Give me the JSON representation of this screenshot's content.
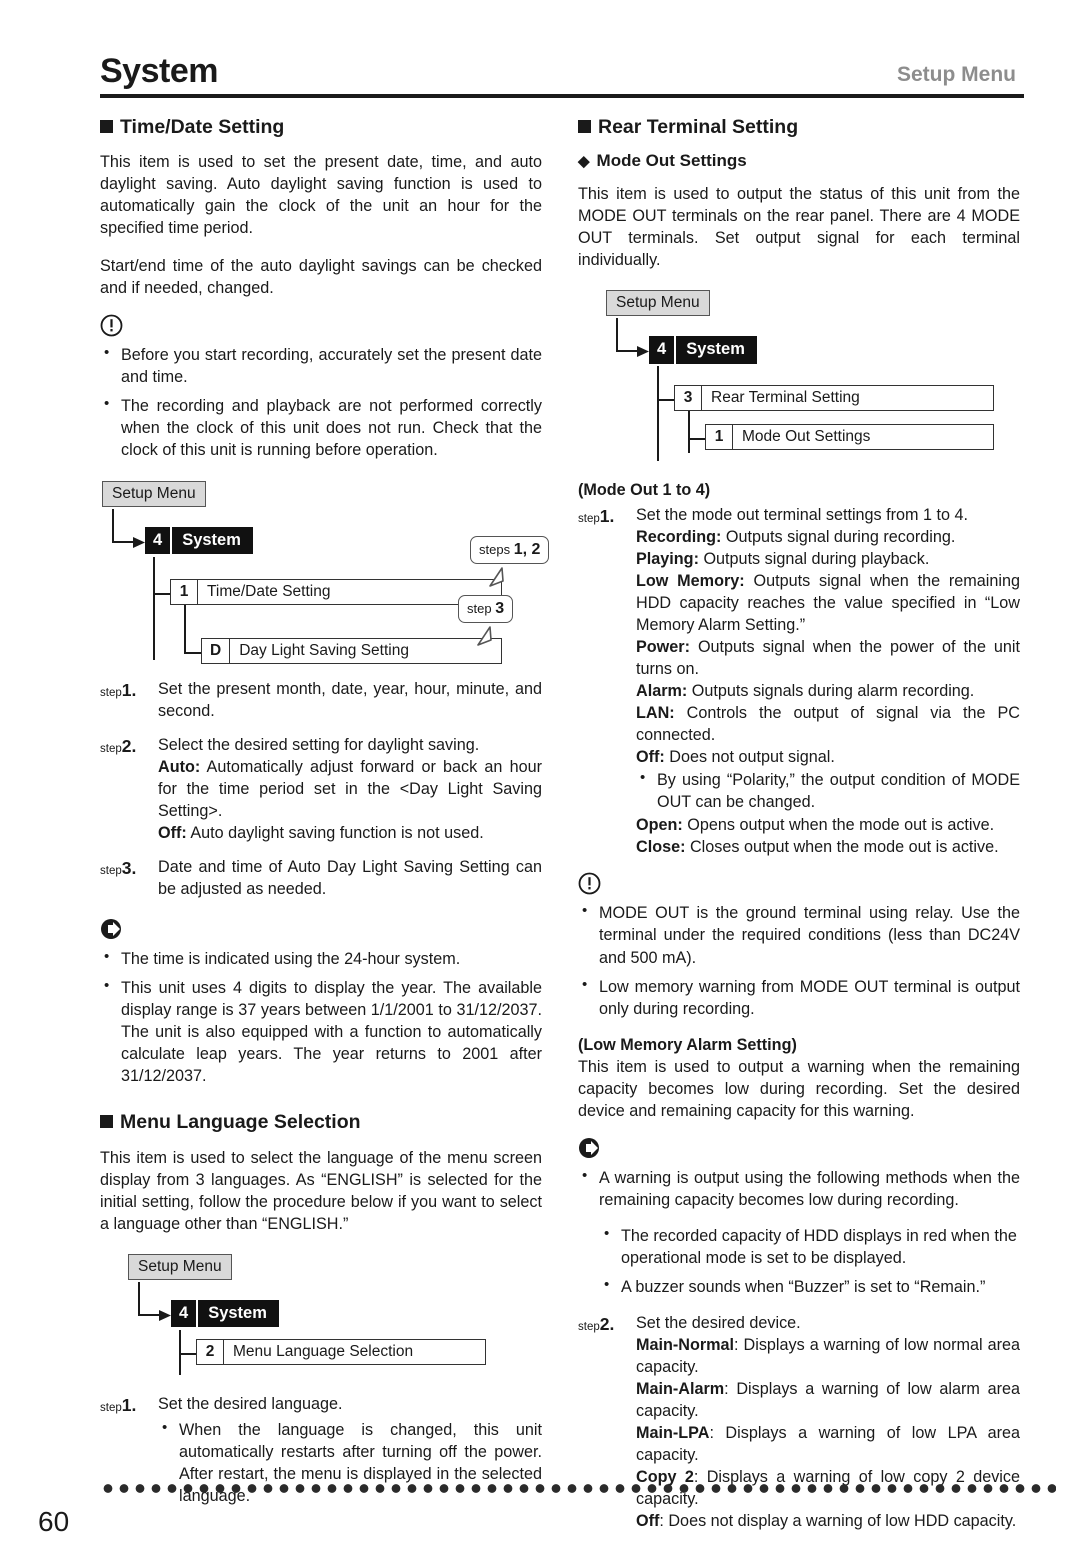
{
  "header": {
    "title": "System",
    "subtitle": "Setup Menu"
  },
  "footer": {
    "page_number": "60"
  },
  "left_column": {
    "section1": {
      "heading": "Time/Date Setting",
      "intro1": "This item is used to set the present date, time, and auto daylight saving. Auto daylight saving function is used to automatically gain the clock of the unit an hour for the specified time period.",
      "intro2": "Start/end time of the auto daylight savings can be checked and if needed, changed.",
      "caution_icon": "warning-exclamation-icon",
      "caution_bullets": [
        "Before you start recording, accurately set the present date and time.",
        "The recording and playback are not performed correctly when the clock of this unit does not run. Check that the clock of this unit is running before operation."
      ],
      "tree": {
        "root": "Setup Menu",
        "system_num": "4",
        "system_label": "System",
        "items": [
          {
            "num": "1",
            "label": "Time/Date Setting",
            "callout_prefix": "steps",
            "callout_value": "1, 2"
          },
          {
            "num": "D",
            "label": "Day Light Saving Setting",
            "callout_prefix": "step",
            "callout_value": "3"
          }
        ]
      },
      "steps": [
        {
          "word": "step",
          "num": "1.",
          "lines": [
            {
              "text": "Set the present month, date, year, hour, minute, and second."
            }
          ]
        },
        {
          "word": "step",
          "num": "2.",
          "lines": [
            {
              "text": "Select the desired setting for daylight saving."
            },
            {
              "bold": "Auto:",
              "text": " Automatically adjust forward or back an hour for the time period set in the <Day Light Saving Setting>."
            },
            {
              "bold": "Off:",
              "text": " Auto daylight saving function is not used."
            }
          ]
        },
        {
          "word": "step",
          "num": "3.",
          "lines": [
            {
              "text": "Date and time of Auto Day Light Saving Setting can be adjusted as needed."
            }
          ]
        }
      ],
      "note_icon": "arrow-right-circle-icon",
      "note_bullets": [
        "The time is indicated using the 24-hour system.",
        "This unit uses 4 digits to display the year. The available display range is 37 years between 1/1/2001 to 31/12/2037. The unit is also equipped with a function to automatically calculate leap years. The year returns to 2001 after 31/12/2037."
      ]
    },
    "section2": {
      "heading": "Menu Language Selection",
      "intro": "This item is used to select the language of the menu screen display from 3 languages. As “ENGLISH” is selected for the initial setting, follow the procedure below if you want to select a language other than “ENGLISH.”",
      "tree": {
        "root": "Setup Menu",
        "system_num": "4",
        "system_label": "System",
        "items": [
          {
            "num": "2",
            "label": "Menu Language Selection"
          }
        ]
      },
      "steps": [
        {
          "word": "step",
          "num": "1.",
          "lines": [
            {
              "text": "Set the desired language."
            }
          ],
          "bullets": [
            "When the language is changed, this unit automatically restarts after turning off the power. After restart, the menu is displayed in the selected language."
          ]
        }
      ]
    }
  },
  "right_column": {
    "section1": {
      "heading": "Rear Terminal Setting",
      "subheading": "Mode Out Settings",
      "subheading_bullet": "diamond",
      "intro": "This item is used to output the status of this unit from the MODE OUT terminals on the rear panel. There are 4 MODE OUT terminals. Set output signal for each terminal individually.",
      "tree": {
        "root": "Setup Menu",
        "system_num": "4",
        "system_label": "System",
        "items": [
          {
            "num": "3",
            "label": "Rear Terminal Setting"
          },
          {
            "num": "1",
            "label": "Mode Out Settings"
          }
        ]
      },
      "group_title": "(Mode Out 1 to 4)",
      "steps": [
        {
          "word": "step",
          "num": "1.",
          "lines": [
            {
              "text": "Set the mode out terminal settings from 1 to 4."
            },
            {
              "bold": "Recording:",
              "text": " Outputs signal during recording."
            },
            {
              "bold": "Playing:",
              "text": " Outputs signal during playback."
            },
            {
              "bold": "Low Memory:",
              "text": " Outputs signal when the remaining HDD capacity reaches the value specified in “Low Memory Alarm Setting.”"
            },
            {
              "bold": "Power:",
              "text": " Outputs signal when the power of the unit turns on."
            },
            {
              "bold": "Alarm:",
              "text": " Outputs signals during alarm recording."
            },
            {
              "bold": "LAN:",
              "text": " Controls the output of signal via the PC connected."
            },
            {
              "bold": "Off:",
              "text": " Does not output signal."
            }
          ],
          "bullets": [
            "By using “Polarity,” the output condition of MODE OUT can be changed."
          ],
          "lines_after": [
            {
              "bold": "Open:",
              "text": " Opens output when the mode out is active."
            },
            {
              "bold": "Close:",
              "text": " Closes output when the mode out is active."
            }
          ]
        }
      ],
      "caution_icon": "warning-exclamation-icon",
      "caution_bullets": [
        "MODE OUT is the ground terminal using relay. Use the terminal under the required conditions (less than DC24V and 500 mA).",
        "Low memory warning from MODE OUT terminal is output only during recording."
      ],
      "group_title2": "(Low Memory Alarm Setting)",
      "intro2": "This item is used to output a warning when the remaining capacity becomes low during recording. Set the desired device and remaining capacity for this warning.",
      "note_icon": "arrow-right-circle-icon",
      "note_bullets": [
        "A warning is output using the following methods when the remaining capacity becomes low during recording."
      ],
      "note_subbullets": [
        "The recorded capacity of HDD displays in red when the operational mode is set to be displayed.",
        "A buzzer sounds when “Buzzer” is set to “Remain.”"
      ],
      "steps2": [
        {
          "word": "step",
          "num": "2.",
          "lines": [
            {
              "text": "Set the desired device."
            },
            {
              "bold": "Main-Normal",
              "text": ": Displays a warning of low normal area capacity."
            },
            {
              "bold": "Main-Alarm",
              "text": ": Displays a warning of low alarm area capacity."
            },
            {
              "bold": "Main-LPA",
              "text": ": Displays a warning of low LPA area capacity."
            },
            {
              "bold": "Copy 2",
              "text": ": Displays a warning of low copy 2 device capacity."
            },
            {
              "bold": "Off",
              "text": ": Does not display a warning of low HDD capacity."
            }
          ]
        }
      ]
    }
  }
}
